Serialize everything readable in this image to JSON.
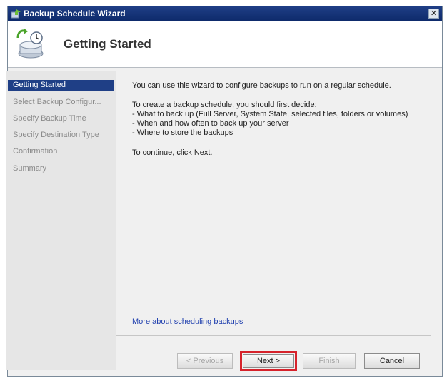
{
  "window": {
    "title": "Backup Schedule Wizard",
    "close_glyph": "✕"
  },
  "header": {
    "title": "Getting Started",
    "icon": "backup-schedule-icon"
  },
  "nav": {
    "items": [
      {
        "label": "Getting Started",
        "active": true
      },
      {
        "label": "Select Backup Configur...",
        "active": false
      },
      {
        "label": "Specify Backup Time",
        "active": false
      },
      {
        "label": "Specify Destination Type",
        "active": false
      },
      {
        "label": "Confirmation",
        "active": false
      },
      {
        "label": "Summary",
        "active": false
      }
    ]
  },
  "content": {
    "intro": "You can use this wizard to configure backups to run on a regular schedule.",
    "decide_heading": "To create a backup schedule, you should first decide:",
    "bullets": [
      "- What to back up (Full Server, System State, selected files, folders or volumes)",
      "- When and how often to back up your server",
      "- Where to store the backups"
    ],
    "continue": "To continue, click Next.",
    "more_link": "More about scheduling backups"
  },
  "buttons": {
    "previous": "< Previous",
    "next": "Next >",
    "finish": "Finish",
    "cancel": "Cancel"
  },
  "colors": {
    "title_bar": "#1f3f86",
    "selected_nav": "#1f3f86",
    "link": "#1f3fae",
    "highlight": "#d6222b"
  }
}
